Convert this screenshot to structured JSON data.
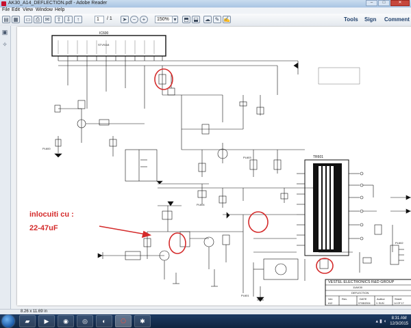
{
  "window": {
    "title": "AK30_A14_DEFLECTION.pdf - Adobe Reader",
    "minimize_icon": "minimize-icon",
    "maximize_icon": "maximize-icon",
    "close_icon": "close-icon"
  },
  "menu": [
    "File",
    "Edit",
    "View",
    "Window",
    "Help"
  ],
  "toolbar": {
    "page_current": "1",
    "page_total": "/ 1",
    "zoom": "150%",
    "tools": "Tools",
    "sign": "Sign",
    "comment": "Comment"
  },
  "status": {
    "page_size": "8.26 x 11.69 in"
  },
  "schematic": {
    "ic_top": "IC600",
    "ic_top_part": "STV9118",
    "transformer": "TR601",
    "annotation_line1": "inlocuiti cu :",
    "annotation_line2": "22-47uF",
    "annotation_color": "#d42a2a",
    "company": "VESTEL ELECTRONICS R&D GROUP",
    "model": "11AK30",
    "sheet_name": "DEFLECTION",
    "labels": {
      "pl600": "PL600",
      "pl603": "PL603",
      "pl604": "PL604",
      "pl601": "PL601",
      "pl602": "PL602",
      "col_ver": "Ver:",
      "col_rev": "Rev.",
      "col_date": "DATE",
      "col_author": "Author",
      "col_sheet": "Sheet",
      "ver_val": "A12",
      "date_val": "07/08/2004",
      "author_val": "V. ELBİ",
      "sheet_val": "14 OF 17"
    }
  },
  "taskbar": {
    "apps": [
      "folder",
      "media-player",
      "chrome",
      "network",
      "firefox",
      "pdf",
      "paint"
    ],
    "time": "8:31 AM",
    "date": "12/3/2015"
  }
}
